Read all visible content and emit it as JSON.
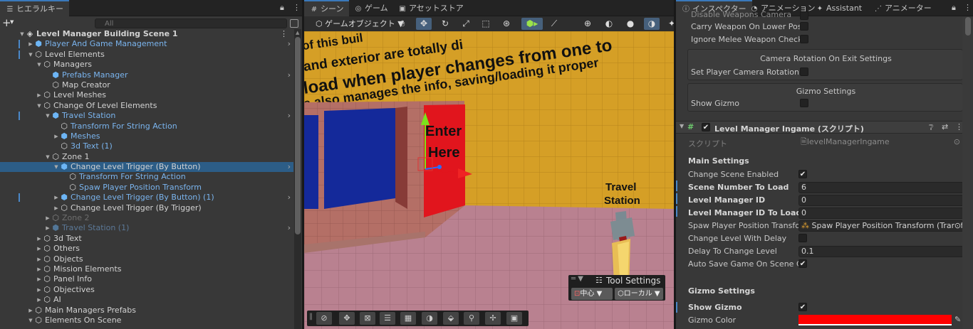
{
  "hierarchy": {
    "tab_label": "ヒエラルキー",
    "search_placeholder": "All",
    "scene_name": "Level Manager Building Scene 1",
    "rows": [
      {
        "text": "Player And Game Management",
        "indent": 1,
        "icon": "prefab",
        "fold": "closed",
        "prefab": true,
        "chevron": true,
        "bar": true
      },
      {
        "text": "Level Elements",
        "indent": 1,
        "icon": "cube",
        "fold": "open",
        "bar": true
      },
      {
        "text": "Managers",
        "indent": 2,
        "icon": "cube",
        "fold": "open"
      },
      {
        "text": "Prefabs Manager",
        "indent": 3,
        "icon": "prefab",
        "fold": "none",
        "prefab": true,
        "chevron": true
      },
      {
        "text": "Map Creator",
        "indent": 3,
        "icon": "cube",
        "fold": "none"
      },
      {
        "text": "Level Meshes",
        "indent": 2,
        "icon": "cube",
        "fold": "closed"
      },
      {
        "text": "Change Of Level Elements",
        "indent": 2,
        "icon": "cube",
        "fold": "open"
      },
      {
        "text": "Travel Station",
        "indent": 3,
        "icon": "prefab",
        "fold": "open",
        "prefab": true,
        "chevron": true,
        "bar": true
      },
      {
        "text": "Transform For String Action",
        "indent": 4,
        "icon": "cube",
        "fold": "none",
        "prefab": true
      },
      {
        "text": "Meshes",
        "indent": 4,
        "icon": "prefab",
        "fold": "closed",
        "prefab": true
      },
      {
        "text": "3d Text (1)",
        "indent": 4,
        "icon": "cube",
        "fold": "none",
        "prefab": true
      },
      {
        "text": "Zone 1",
        "indent": 3,
        "icon": "cube",
        "fold": "open"
      },
      {
        "text": "Change Level Trigger (By Button)",
        "indent": 4,
        "icon": "prefab",
        "fold": "open",
        "sel": true,
        "chevron": true
      },
      {
        "text": "Transform For String Action",
        "indent": 5,
        "icon": "cube",
        "fold": "none",
        "prefab": true
      },
      {
        "text": "Spaw Player Position Transform",
        "indent": 5,
        "icon": "cube",
        "fold": "none",
        "prefab": true
      },
      {
        "text": "Change Level Trigger (By Button) (1)",
        "indent": 4,
        "icon": "prefab",
        "fold": "closed",
        "prefab": true,
        "chevron": true,
        "bar": true
      },
      {
        "text": "Change Level Trigger (By Trigger)",
        "indent": 4,
        "icon": "cube",
        "fold": "closed"
      },
      {
        "text": "Zone 2",
        "indent": 3,
        "icon": "cube",
        "fold": "closed",
        "dis": true
      },
      {
        "text": "Travel Station (1)",
        "indent": 3,
        "icon": "prefab",
        "fold": "closed",
        "prefab": true,
        "dis": true,
        "chevron": true
      },
      {
        "text": "3d Text",
        "indent": 2,
        "icon": "cube",
        "fold": "closed"
      },
      {
        "text": "Others",
        "indent": 2,
        "icon": "cube",
        "fold": "closed"
      },
      {
        "text": "Objects",
        "indent": 2,
        "icon": "cube",
        "fold": "closed"
      },
      {
        "text": "Mission Elements",
        "indent": 2,
        "icon": "cube",
        "fold": "closed"
      },
      {
        "text": "Panel Info",
        "indent": 2,
        "icon": "cube",
        "fold": "closed"
      },
      {
        "text": "Objectives",
        "indent": 2,
        "icon": "cube",
        "fold": "closed"
      },
      {
        "text": "AI",
        "indent": 2,
        "icon": "cube",
        "fold": "closed"
      },
      {
        "text": "Main Managers Prefabs",
        "indent": 1,
        "icon": "cube",
        "fold": "closed"
      },
      {
        "text": "Elements On Scene",
        "indent": 1,
        "icon": "cube",
        "fold": "open"
      }
    ]
  },
  "scene": {
    "tabs": [
      "シーン",
      "ゲーム",
      "アセットストア"
    ],
    "gameobject_menu": "ゲームオブジェクト",
    "wall_text": [
      "of this buil",
      "and exterior are totally di",
      "load when player changes from one to",
      "e also manages the info, saving/loading it proper"
    ],
    "door_text": [
      "Enter",
      "Here"
    ],
    "station_text": [
      "Travel",
      "Station"
    ],
    "tool_settings": {
      "title": "Tool Settings",
      "pivot": "中心",
      "space": "ローカル"
    }
  },
  "inspector": {
    "tabs": [
      "インスペクター",
      "アニメーション",
      "Assistant",
      "アニメーター"
    ],
    "top_rows": [
      "Carry Weapon On Lower Posit",
      "Ignore Melee Weapon Check"
    ],
    "camera_section": {
      "title": "Camera Rotation On Exit Settings",
      "row": "Set Player Camera Rotation On"
    },
    "gizmo_section1": {
      "title": "Gizmo Settings",
      "row": "Show Gizmo"
    },
    "component": {
      "title": "Level Manager Ingame (スクリプト)",
      "script_label": "スクリプト",
      "script_value": "levelManagerIngame",
      "main_settings": "Main Settings",
      "fields": [
        {
          "label": "Change Scene Enabled",
          "type": "check",
          "value": "✔",
          "bold": false
        },
        {
          "label": "Scene Number To Load",
          "type": "text",
          "value": "6",
          "bold": true
        },
        {
          "label": "Level Manager ID",
          "type": "text",
          "value": "0",
          "bold": true
        },
        {
          "label": "Level Manager ID To Load",
          "type": "text",
          "value": "0",
          "bold": true
        },
        {
          "label": "Spaw Player Position Transfor",
          "type": "obj",
          "value": "Spaw Player Position Transform (Transf",
          "bold": false
        },
        {
          "label": "Change Level With Delay",
          "type": "check",
          "value": "",
          "bold": false
        },
        {
          "label": "Delay To Change Level",
          "type": "text",
          "value": "0.1",
          "bold": false
        },
        {
          "label": "Auto Save Game On Scene Ch",
          "type": "check",
          "value": "✔",
          "bold": false
        }
      ],
      "gizmo_settings": "Gizmo Settings",
      "show_gizmo": "Show Gizmo",
      "show_gizmo_value": "✔",
      "gizmo_color_label": "Gizmo Color",
      "gizmo_color": "#ff0000"
    }
  }
}
